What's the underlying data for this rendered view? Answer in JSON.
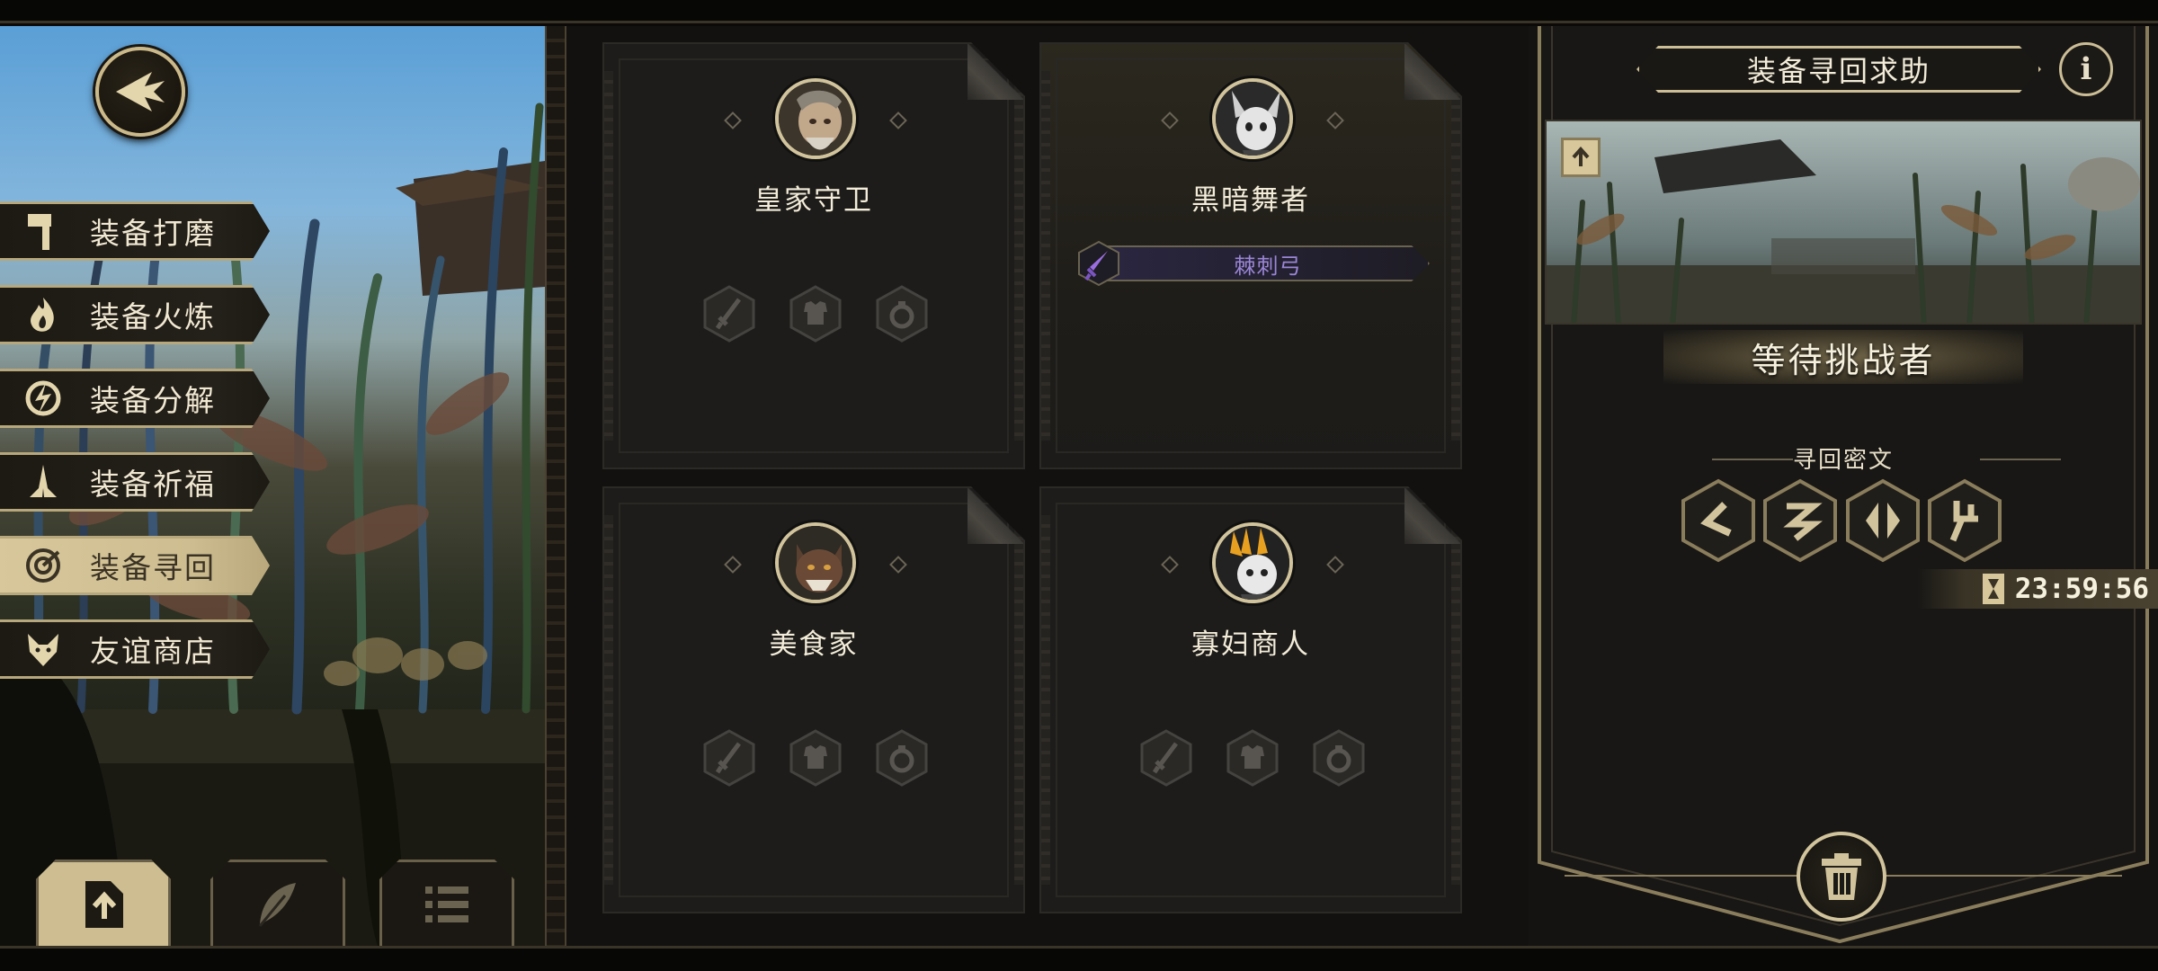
{
  "left_menu": {
    "items": [
      {
        "label": "装备打磨",
        "icon": "hammer-icon",
        "active": false
      },
      {
        "label": "装备火炼",
        "icon": "flame-icon",
        "active": false
      },
      {
        "label": "装备分解",
        "icon": "disassemble-icon",
        "active": false
      },
      {
        "label": "装备祈福",
        "icon": "praying-hands-icon",
        "active": false
      },
      {
        "label": "装备寻回",
        "icon": "target-icon",
        "active": true
      },
      {
        "label": "友谊商店",
        "icon": "fox-icon",
        "active": false
      }
    ]
  },
  "bottom_tabs": [
    {
      "icon": "upload-document-icon",
      "active": true
    },
    {
      "icon": "feather-icon",
      "active": false
    },
    {
      "icon": "list-icon",
      "active": false
    }
  ],
  "cards": [
    {
      "name": "皇家守卫",
      "avatar": "royal-guard-avatar",
      "weapon": null
    },
    {
      "name": "黑暗舞者",
      "avatar": "dark-dancer-avatar",
      "weapon": {
        "label": "棘刺弓",
        "icon": "purple-dagger-icon"
      }
    },
    {
      "name": "美食家",
      "avatar": "gourmet-avatar",
      "weapon": null
    },
    {
      "name": "寡妇商人",
      "avatar": "widow-merchant-avatar",
      "weapon": null
    }
  ],
  "slot_icons": [
    "sword-icon",
    "armor-icon",
    "ring-icon"
  ],
  "right_panel": {
    "title": "装备寻回求助",
    "info_icon": "i",
    "status": "等待挑战者",
    "cipher_label": "寻回密文",
    "runes": [
      "rune-1-icon",
      "rune-2-icon",
      "rune-3-icon",
      "rune-4-icon"
    ],
    "timer": "23:59:56"
  },
  "colors": {
    "accent_gold": "#cbbd95",
    "active_tab": "#d7c79b",
    "weapon_text": "#9b86d6"
  }
}
